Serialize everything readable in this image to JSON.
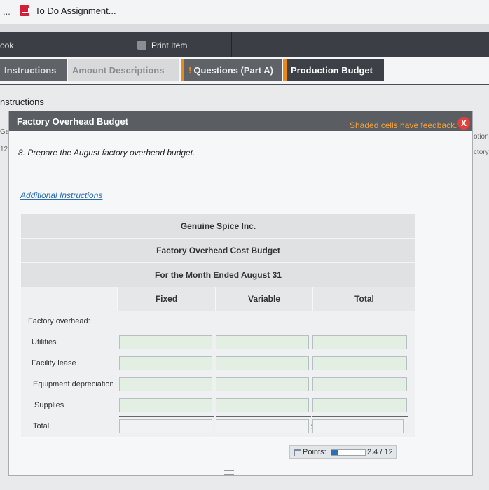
{
  "window": {
    "dash": "...",
    "title": "To Do Assignment..."
  },
  "nav": {
    "book": "ook",
    "print": "Print Item"
  },
  "tabs": [
    {
      "label": "Instructions"
    },
    {
      "label": "Amount Descriptions"
    },
    {
      "bang": "!",
      "label": "Questions (Part A)"
    },
    {
      "label": "Production Budget"
    }
  ],
  "instructions_heading": "nstructions",
  "modal": {
    "title": "Factory Overhead Budget",
    "feedback": "Shaded cells have feedback.",
    "close": "X",
    "prompt": "8. Prepare the August factory overhead budget.",
    "additional": "Additional Instructions"
  },
  "side": {
    "left1": "Ge",
    "left2": "12",
    "right1": "otion",
    "right2": "ctory"
  },
  "budget": {
    "company": "Genuine Spice Inc.",
    "name": "Factory Overhead Cost Budget",
    "period": "For the Month Ended August 31",
    "columns": [
      "Fixed",
      "Variable",
      "Total"
    ],
    "section": "Factory overhead:",
    "currency": "$",
    "rows": [
      {
        "label": "Utilities",
        "fixed": "",
        "variable": "",
        "total": ""
      },
      {
        "label": "Facility lease",
        "fixed": "",
        "variable": "",
        "total": ""
      },
      {
        "label": "Equipment depreciation",
        "fixed": "",
        "variable": "",
        "total": ""
      },
      {
        "label": "Supplies",
        "fixed": "",
        "variable": "",
        "total": ""
      },
      {
        "label": "Total",
        "fixed": "",
        "variable": "",
        "total": ""
      }
    ]
  },
  "points": {
    "label": "Points:",
    "value": "2.4 / 12",
    "progress": 0.2
  }
}
